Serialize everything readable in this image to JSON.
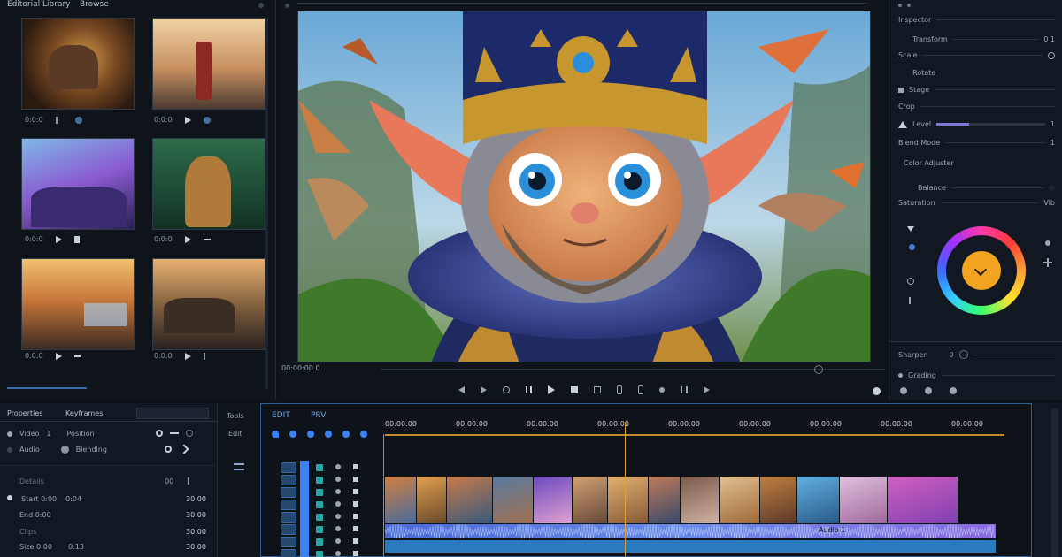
{
  "media_panel": {
    "title": "Editorial Library",
    "tab": "Browse",
    "thumbs": [
      {
        "meta": "0:0:0"
      },
      {
        "meta": "0:0:0"
      },
      {
        "meta": "0:0:0"
      },
      {
        "meta": "0:0:0"
      },
      {
        "meta": "0:0:0"
      },
      {
        "meta": "0:0:0"
      }
    ]
  },
  "viewer": {
    "timecode_left": "00:00:00 0",
    "controls": [
      "rewind",
      "step-back",
      "prev-mark",
      "pause",
      "play",
      "stop",
      "loop",
      "mark-in",
      "mark-out",
      "record",
      "prev",
      "next"
    ]
  },
  "inspector": {
    "rows": [
      {
        "label": "Inspector"
      },
      {
        "label": "Transform"
      },
      {
        "label": "Scale"
      },
      {
        "label": "Rotate"
      },
      {
        "label": "Stage"
      },
      {
        "label": "Crop"
      },
      {
        "label": "Level"
      },
      {
        "label": "Blend Mode"
      },
      {
        "label": "Color Adjuster"
      },
      {
        "label": "Balance"
      },
      {
        "label": "Saturation"
      }
    ],
    "level_value": "1",
    "blend_value": "1",
    "saturation_value": "Vib",
    "lower_row1": "Sharpen",
    "lower_row1_value": "0",
    "lower_row2": "Grading"
  },
  "props": {
    "header": "Properties",
    "tab2": "Keyframes",
    "rows": [
      {
        "label": "Video",
        "value": "1",
        "extra": "Position"
      },
      {
        "label": "Audio",
        "value": "",
        "extra": "Blending"
      },
      {
        "label": "Details",
        "value": "00",
        "extra": ""
      },
      {
        "label": "Start 0:00",
        "value": "0:04",
        "extra": "30.00"
      },
      {
        "label": "End 0:00",
        "value": "",
        "extra": "30.00"
      },
      {
        "label": "Clips",
        "value": "",
        "extra": "30.00"
      },
      {
        "label": "Size 0:00",
        "value": "0:13",
        "extra": "30.00"
      }
    ]
  },
  "mid": {
    "label1": "Tools",
    "label2": "Edit"
  },
  "timeline": {
    "title": "EDIT",
    "subtitle": "PRV",
    "ruler": [
      "00:00:00",
      "00:00:00",
      "00:00:00",
      "00:00:00",
      "00:00:00",
      "00:00:00",
      "00:00:00",
      "00:00:00",
      "00:00:00"
    ],
    "audio_label": "Audio 1",
    "colors": {
      "accent": "#3b82f6",
      "playhead": "#e0a030",
      "waveform": "#6fa8dc"
    }
  }
}
